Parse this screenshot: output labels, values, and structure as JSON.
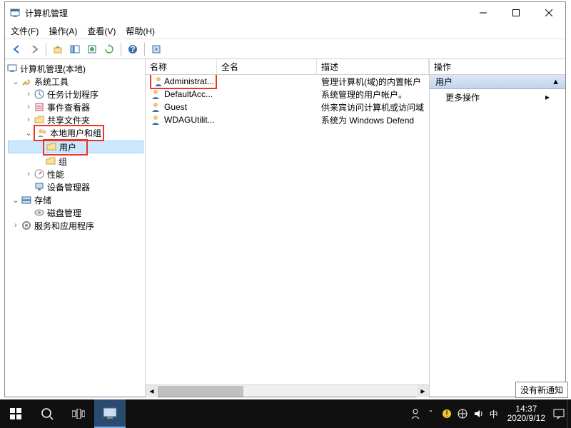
{
  "window": {
    "title": "计算机管理"
  },
  "menubar": {
    "file": "文件(F)",
    "action": "操作(A)",
    "view": "查看(V)",
    "help": "帮助(H)"
  },
  "tree": {
    "root": "计算机管理(本地)",
    "system_tools": "系统工具",
    "task_scheduler": "任务计划程序",
    "event_viewer": "事件查看器",
    "shared_folders": "共享文件夹",
    "local_users_groups": "本地用户和组",
    "users": "用户",
    "groups": "组",
    "performance": "性能",
    "device_manager": "设备管理器",
    "storage": "存储",
    "disk_management": "磁盘管理",
    "services_apps": "服务和应用程序"
  },
  "list": {
    "col_name": "名称",
    "col_fullname": "全名",
    "col_description": "描述",
    "rows": [
      {
        "name": "Administrat...",
        "fullname": "",
        "desc": "管理计算机(域)的内置帐户"
      },
      {
        "name": "DefaultAcc...",
        "fullname": "",
        "desc": "系统管理的用户帐户。"
      },
      {
        "name": "Guest",
        "fullname": "",
        "desc": "供来宾访问计算机或访问域"
      },
      {
        "name": "WDAGUtilit...",
        "fullname": "",
        "desc": "系统为 Windows Defend"
      }
    ]
  },
  "actions": {
    "header": "操作",
    "sub": "用户",
    "more": "更多操作"
  },
  "notification_tip": "没有新通知",
  "taskbar": {
    "ime": "中",
    "time": "14:37",
    "date": "2020/9/12"
  }
}
